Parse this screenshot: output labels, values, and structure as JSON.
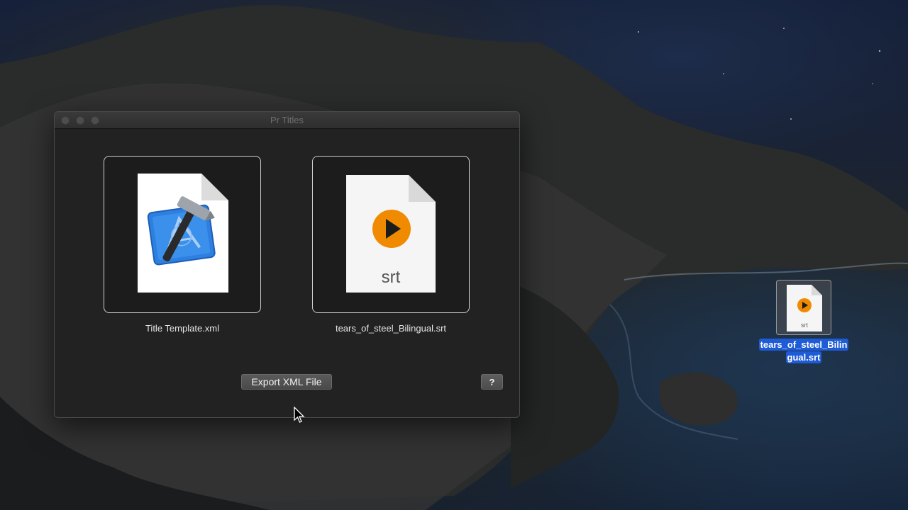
{
  "window": {
    "title": "Pr Titles"
  },
  "files": [
    {
      "name": "Title Template.xml",
      "icon": "xcode-document-icon"
    },
    {
      "name": "tears_of_steel_Bilingual.srt",
      "icon": "srt-file-icon",
      "icon_text": "srt"
    }
  ],
  "buttons": {
    "export": "Export XML File",
    "help": "?"
  },
  "desktop": {
    "file_line1": "tears_of_steel_Bilin",
    "file_line2": "gual.srt",
    "icon_text": "srt"
  },
  "colors": {
    "selection": "#1e5bd6",
    "play_orange": "#f08a00"
  }
}
